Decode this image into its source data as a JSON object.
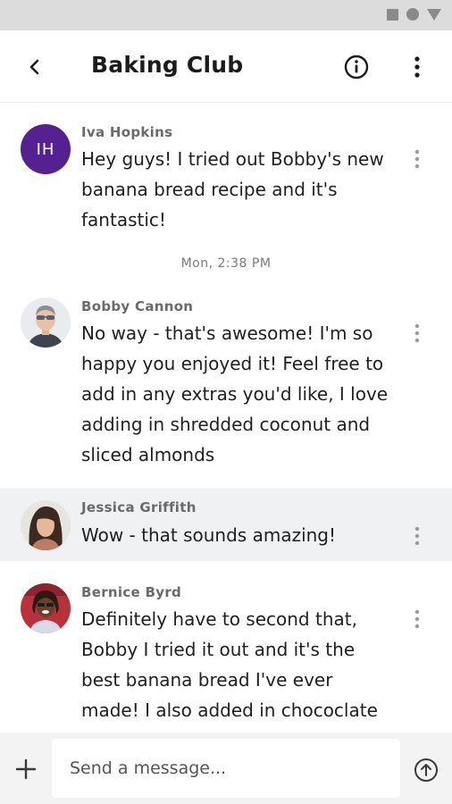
{
  "header": {
    "title": "Baking Club",
    "back_icon": "back-arrow-icon",
    "info_icon": "info-icon",
    "more_icon": "more-vertical-icon"
  },
  "status_bar": {
    "icons": [
      "square-icon",
      "circle-icon",
      "triangle-icon"
    ]
  },
  "messages": [
    {
      "sender": "Iva Hopkins",
      "avatar": {
        "type": "initials",
        "initials": "IH",
        "color": "#55208f"
      },
      "lines": [
        "Hey guys! I tried out Bobby's new",
        "banana bread recipe and it's",
        "fantastic!"
      ]
    },
    {
      "sender": "Bobby Cannon",
      "avatar": {
        "type": "photo"
      },
      "lines": [
        "No way - that's awesome! I'm so",
        "happy you enjoyed it! Feel free to",
        "add in any extras you'd like, I love",
        "adding in shredded coconut and",
        "sliced almonds"
      ]
    },
    {
      "sender": "Jessica Griffith",
      "avatar": {
        "type": "photo"
      },
      "highlighted": true,
      "lines": [
        "Wow - that sounds amazing!"
      ]
    },
    {
      "sender": "Bernice Byrd",
      "avatar": {
        "type": "photo"
      },
      "lines": [
        "Definitely have to second that,",
        "Bobby I tried it out and it's the",
        "best banana bread I've ever",
        "made! I also added in chococlate"
      ]
    }
  ],
  "timestamp": "Mon, 2:38 PM",
  "composer": {
    "placeholder": "Send a message...",
    "add_icon": "plus-icon",
    "send_icon": "send-arrow-icon"
  },
  "colors": {
    "accent": "#55208f",
    "highlight_bg": "#eff1f3",
    "status_bar_bg": "#dcdcdc",
    "composer_bg": "#f3f3f3"
  }
}
